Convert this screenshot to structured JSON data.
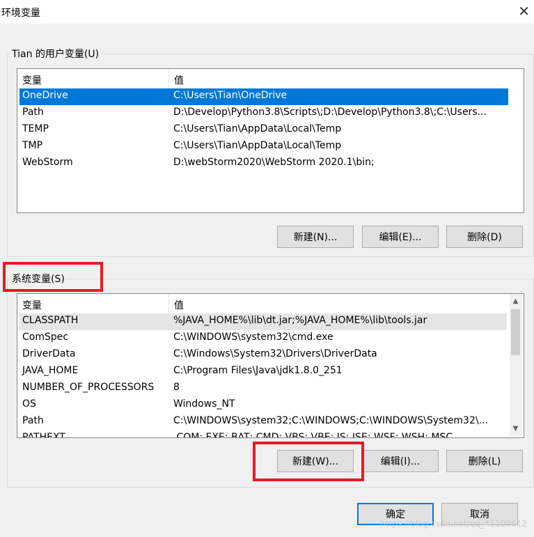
{
  "window": {
    "title": "环境变量",
    "close_glyph": "✕"
  },
  "user_vars": {
    "group_label": "Tian 的用户变量(U)",
    "headers": [
      "变量",
      "值"
    ],
    "rows": [
      {
        "name": "OneDrive",
        "value": "C:\\Users\\Tian\\OneDrive",
        "selected": true
      },
      {
        "name": "Path",
        "value": "D:\\Develop\\Python3.8\\Scripts\\;D:\\Develop\\Python3.8\\;C:\\Users..."
      },
      {
        "name": "TEMP",
        "value": "C:\\Users\\Tian\\AppData\\Local\\Temp"
      },
      {
        "name": "TMP",
        "value": "C:\\Users\\Tian\\AppData\\Local\\Temp"
      },
      {
        "name": "WebStorm",
        "value": "D:\\webStorm2020\\WebStorm 2020.1\\bin;"
      }
    ],
    "buttons": {
      "new": "新建(N)...",
      "edit": "编辑(E)...",
      "delete": "删除(D)"
    }
  },
  "system_vars": {
    "group_label": "系统变量(S)",
    "headers": [
      "变量",
      "值"
    ],
    "rows": [
      {
        "name": "CLASSPATH",
        "value": "%JAVA_HOME%\\lib\\dt.jar;%JAVA_HOME%\\lib\\tools.jar"
      },
      {
        "name": "ComSpec",
        "value": "C:\\WINDOWS\\system32\\cmd.exe"
      },
      {
        "name": "DriverData",
        "value": "C:\\Windows\\System32\\Drivers\\DriverData"
      },
      {
        "name": "JAVA_HOME",
        "value": "C:\\Program Files\\Java\\jdk1.8.0_251"
      },
      {
        "name": "NUMBER_OF_PROCESSORS",
        "value": "8"
      },
      {
        "name": "OS",
        "value": "Windows_NT"
      },
      {
        "name": "Path",
        "value": "C:\\WINDOWS\\system32;C:\\WINDOWS;C:\\WINDOWS\\System32\\..."
      },
      {
        "name": "PATHEXT",
        "value": ".COM;.EXE;.BAT;.CMD;.VBS;.VBE;.JS;.JSE;.WSF;.WSH;.MSC"
      }
    ],
    "buttons": {
      "new": "新建(W)...",
      "edit": "编辑(I)...",
      "delete": "删除(L)"
    }
  },
  "dialog_buttons": {
    "ok": "确定",
    "cancel": "取消"
  },
  "watermark": "https://blog.csdn.net/qq_45109612",
  "colors": {
    "selection": "#0078d7",
    "annotation": "#e51b24"
  }
}
